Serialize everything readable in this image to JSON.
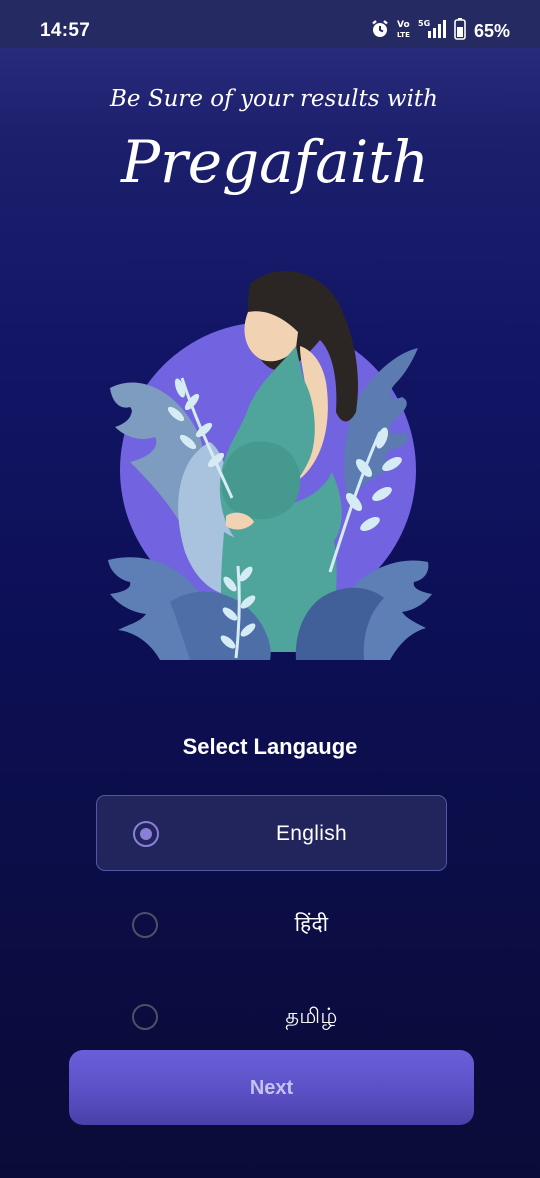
{
  "status_bar": {
    "time": "14:57",
    "battery_percent": "65%",
    "network_label": "5G",
    "icons": [
      "alarm-icon",
      "volte-icon",
      "signal-icon",
      "battery-icon"
    ]
  },
  "header": {
    "tagline": "Be Sure of your results with",
    "brand_name": "Pregafaith"
  },
  "illustration": {
    "subject": "pregnant-woman-illustration"
  },
  "language": {
    "title": "Select Langauge",
    "options": [
      {
        "label": "English",
        "selected": true
      },
      {
        "label": "हिंदी",
        "selected": false
      },
      {
        "label": "தமிழ்",
        "selected": false
      }
    ]
  },
  "actions": {
    "next_label": "Next"
  },
  "colors": {
    "background_top": "#2e3182",
    "background_bottom": "#0a0c38",
    "accent": "#6a5fd8",
    "radio_selected": "#8a80da"
  }
}
